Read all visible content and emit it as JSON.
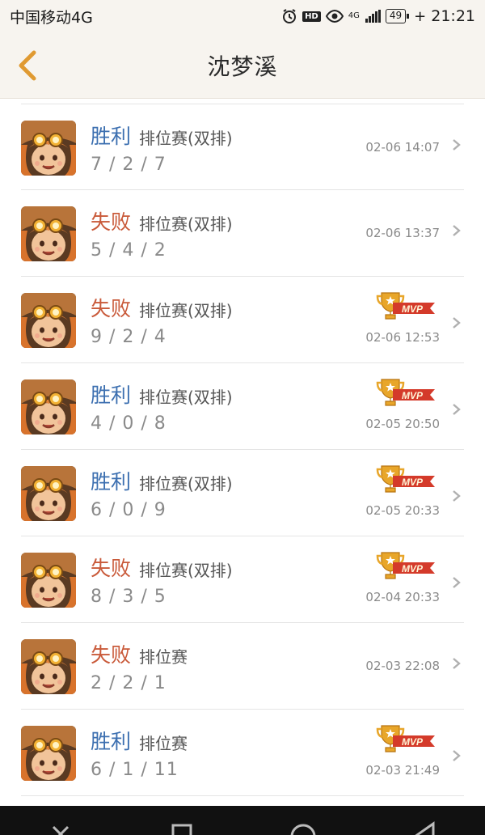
{
  "status_bar": {
    "carrier": "中国移动4G",
    "network": "4G",
    "battery": "49",
    "time": "21:21"
  },
  "header": {
    "title": "沈梦溪"
  },
  "colors": {
    "win": "#3c6fb0",
    "lose": "#c95a3a",
    "accent": "#e09a32"
  },
  "matches": [
    {
      "result": "胜利",
      "outcome": "win",
      "mode": "排位赛(双排)",
      "kda": "7 / 2 / 7",
      "time": "02-06 14:07",
      "mvp": false,
      "mvp_label": ""
    },
    {
      "result": "失败",
      "outcome": "lose",
      "mode": "排位赛(双排)",
      "kda": "5 / 4 / 2",
      "time": "02-06 13:37",
      "mvp": false,
      "mvp_label": ""
    },
    {
      "result": "失败",
      "outcome": "lose",
      "mode": "排位赛(双排)",
      "kda": "9 / 2 / 4",
      "time": "02-06 12:53",
      "mvp": true,
      "mvp_label": "MVP"
    },
    {
      "result": "胜利",
      "outcome": "win",
      "mode": "排位赛(双排)",
      "kda": "4 / 0 / 8",
      "time": "02-05 20:50",
      "mvp": true,
      "mvp_label": "MVP"
    },
    {
      "result": "胜利",
      "outcome": "win",
      "mode": "排位赛(双排)",
      "kda": "6 / 0 / 9",
      "time": "02-05 20:33",
      "mvp": true,
      "mvp_label": "MVP"
    },
    {
      "result": "失败",
      "outcome": "lose",
      "mode": "排位赛(双排)",
      "kda": "8 / 3 / 5",
      "time": "02-04 20:33",
      "mvp": true,
      "mvp_label": "MVP"
    },
    {
      "result": "失败",
      "outcome": "lose",
      "mode": "排位赛",
      "kda": "2 / 2 / 1",
      "time": "02-03 22:08",
      "mvp": false,
      "mvp_label": ""
    },
    {
      "result": "胜利",
      "outcome": "win",
      "mode": "排位赛",
      "kda": "6 / 1 / 11",
      "time": "02-03 21:49",
      "mvp": true,
      "mvp_label": "MVP"
    }
  ],
  "icons": {
    "back": "chevron-left-icon",
    "row_arrow": "chevron-right-icon",
    "mvp": "trophy-mvp-icon",
    "avatar": "hero-avatar-icon"
  }
}
